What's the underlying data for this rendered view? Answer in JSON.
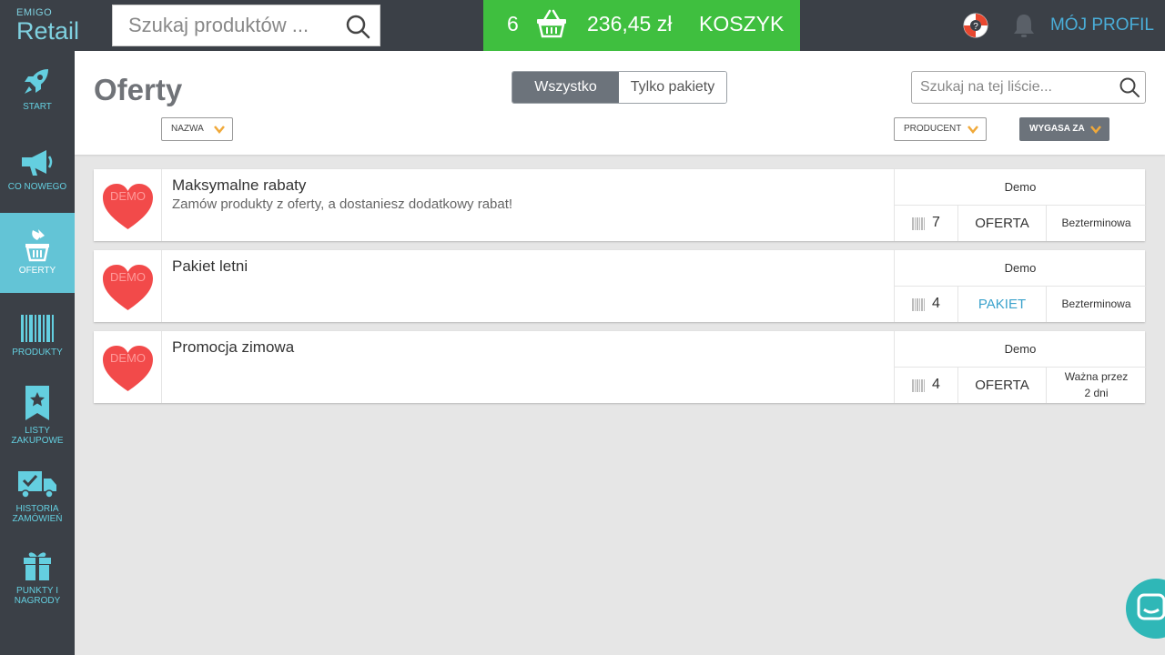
{
  "brand": {
    "small": "EMIGO",
    "big": "Retail"
  },
  "search": {
    "placeholder": "Szukaj produktów ..."
  },
  "cart": {
    "count": "6",
    "total": "236,45 zł",
    "label": "KOSZYK"
  },
  "header": {
    "profile_label": "MÓJ PROFIL"
  },
  "sidebar": {
    "items": [
      {
        "label": "START",
        "icon": "rocket-icon",
        "active": false
      },
      {
        "label": "CO NOWEGO",
        "icon": "megaphone-icon",
        "active": false
      },
      {
        "label": "OFERTY",
        "icon": "offer-basket-icon",
        "active": true
      },
      {
        "label": "PRODUKTY",
        "icon": "barcode-icon",
        "active": false
      },
      {
        "label": "LISTY ZAKUPOWE",
        "icon": "bookmark-star-icon",
        "active": false
      },
      {
        "label": "HISTORIA ZAMÓWIEŃ",
        "icon": "delivery-truck-icon",
        "active": false
      },
      {
        "label": "PUNKTY I NAGRODY",
        "icon": "gift-icon",
        "active": false
      }
    ]
  },
  "page": {
    "title": "Oferty",
    "filter_all": "Wszystko",
    "filter_packages": "Tylko pakiety",
    "list_search_placeholder": "Szukaj na tej liście...",
    "sort_name": "NAZWA",
    "sort_producer": "PRODUCENT",
    "sort_expires": "WYGASA ZA"
  },
  "offers": [
    {
      "thumb": "DEMO",
      "title": "Maksymalne rabaty",
      "desc": "Zamów produkty z oferty, a dostaniesz dodatkowy rabat!",
      "producer": "Demo",
      "count": "7",
      "type": "OFERTA",
      "expires": "Bezterminowa"
    },
    {
      "thumb": "DEMO",
      "title": "Pakiet letni",
      "desc": "",
      "producer": "Demo",
      "count": "4",
      "type": "PAKIET",
      "expires": "Bezterminowa"
    },
    {
      "thumb": "DEMO",
      "title": "Promocja zimowa",
      "desc": "",
      "producer": "Demo",
      "count": "4",
      "type": "OFERTA",
      "expires_line1": "Ważna przez",
      "expires_line2": "2 dni"
    }
  ],
  "colors": {
    "topbar": "#3b4047",
    "accent": "#63c4d6",
    "cart_green": "#3fbf3f",
    "heart_red": "#f24a4a",
    "link_blue": "#3aa2cc"
  }
}
